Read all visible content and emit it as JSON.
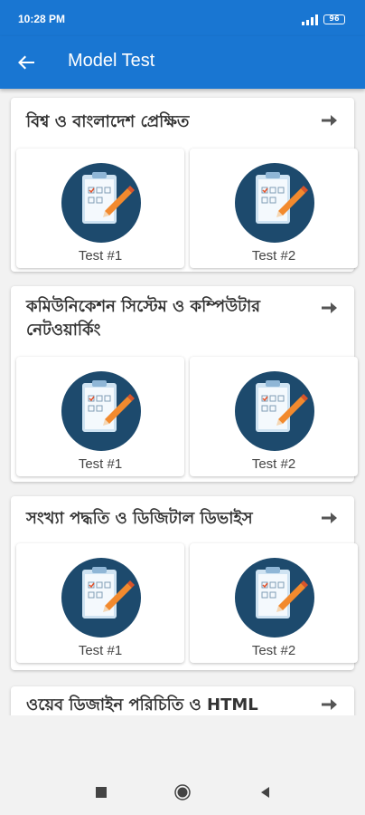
{
  "status_bar": {
    "time": "10:28 PM",
    "battery": "96",
    "icons": [
      "signal-icon",
      "battery-icon"
    ]
  },
  "app_bar": {
    "title": "Model Test",
    "back_icon": "arrow-back-icon",
    "color": "#1976d2"
  },
  "sections": [
    {
      "title": "বিশ্ব ও বাংলাদেশ প্রেক্ষিত",
      "tests": [
        "Test #1",
        "Test #2"
      ]
    },
    {
      "title": "কমিউনিকেশন সিস্টেম ও কম্পিউটার নেটওয়ার্কিং",
      "tests": [
        "Test #1",
        "Test #2"
      ]
    },
    {
      "title": "সংখ্যা পদ্ধতি ও ডিজিটাল ডিভাইস",
      "tests": [
        "Test #1",
        "Test #2"
      ]
    },
    {
      "title": "ওয়েব ডিজাইন পরিচিতি ও HTML",
      "tests": []
    }
  ],
  "test_icon": "clipboard-checklist-icon",
  "test_icon_letters": [
    "a",
    "b",
    "c"
  ],
  "section_arrow_icon": "arrow-forward-icon",
  "nav_bar": {
    "icons": [
      "square-recents-icon",
      "circle-home-icon",
      "triangle-back-icon"
    ]
  }
}
